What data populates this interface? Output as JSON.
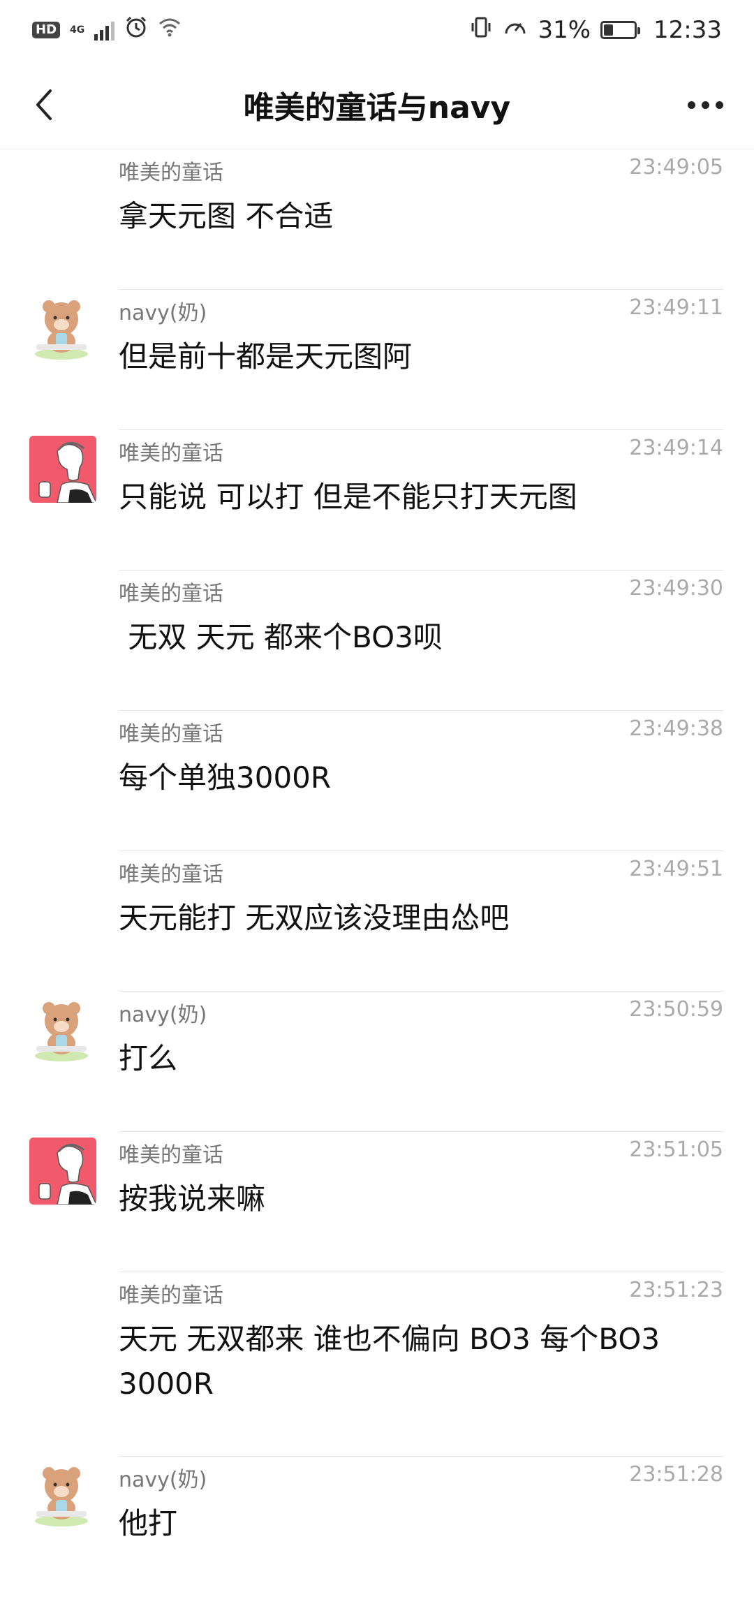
{
  "status_bar": {
    "hd": "HD",
    "network": "4G",
    "battery_percent": "31%",
    "battery_level": 0.31,
    "time": "12:33",
    "icons": [
      "hd-icon",
      "signal-icon",
      "alarm-icon",
      "wifi-icon",
      "vibrate-icon",
      "speed-icon",
      "battery-icon"
    ]
  },
  "header": {
    "title": "唯美的童话与navy",
    "back_icon": "chevron-left-icon",
    "more_icon": "more-dots-icon"
  },
  "messages": [
    {
      "sender": "唯美的童话",
      "time": "23:49:05",
      "text": "拿天元图 不合适",
      "avatar": "none"
    },
    {
      "sender": "navy(奶)",
      "time": "23:49:11",
      "text": "但是前十都是天元图阿",
      "avatar": "bear-avatar"
    },
    {
      "sender": "唯美的童话",
      "time": "23:49:14",
      "text": "只能说 可以打 但是不能只打天元图",
      "avatar": "woman-avatar"
    },
    {
      "sender": "唯美的童话",
      "time": "23:49:30",
      "text": " 无双 天元 都来个BO3呗",
      "avatar": "none"
    },
    {
      "sender": "唯美的童话",
      "time": "23:49:38",
      "text": "每个单独3000R",
      "avatar": "none"
    },
    {
      "sender": "唯美的童话",
      "time": "23:49:51",
      "text": "天元能打 无双应该没理由怂吧",
      "avatar": "none"
    },
    {
      "sender": "navy(奶)",
      "time": "23:50:59",
      "text": "打么",
      "avatar": "bear-avatar"
    },
    {
      "sender": "唯美的童话",
      "time": "23:51:05",
      "text": "按我说来嘛",
      "avatar": "woman-avatar"
    },
    {
      "sender": "唯美的童话",
      "time": "23:51:23",
      "text": "天元 无双都来 谁也不偏向 BO3 每个BO3\n3000R",
      "avatar": "none"
    },
    {
      "sender": "navy(奶)",
      "time": "23:51:28",
      "text": "他打",
      "avatar": "bear-avatar"
    }
  ],
  "colors": {
    "woman_avatar_bg": "#f05a6a",
    "bear_body": "#d9a27a",
    "divider": "#e6e6e6"
  }
}
